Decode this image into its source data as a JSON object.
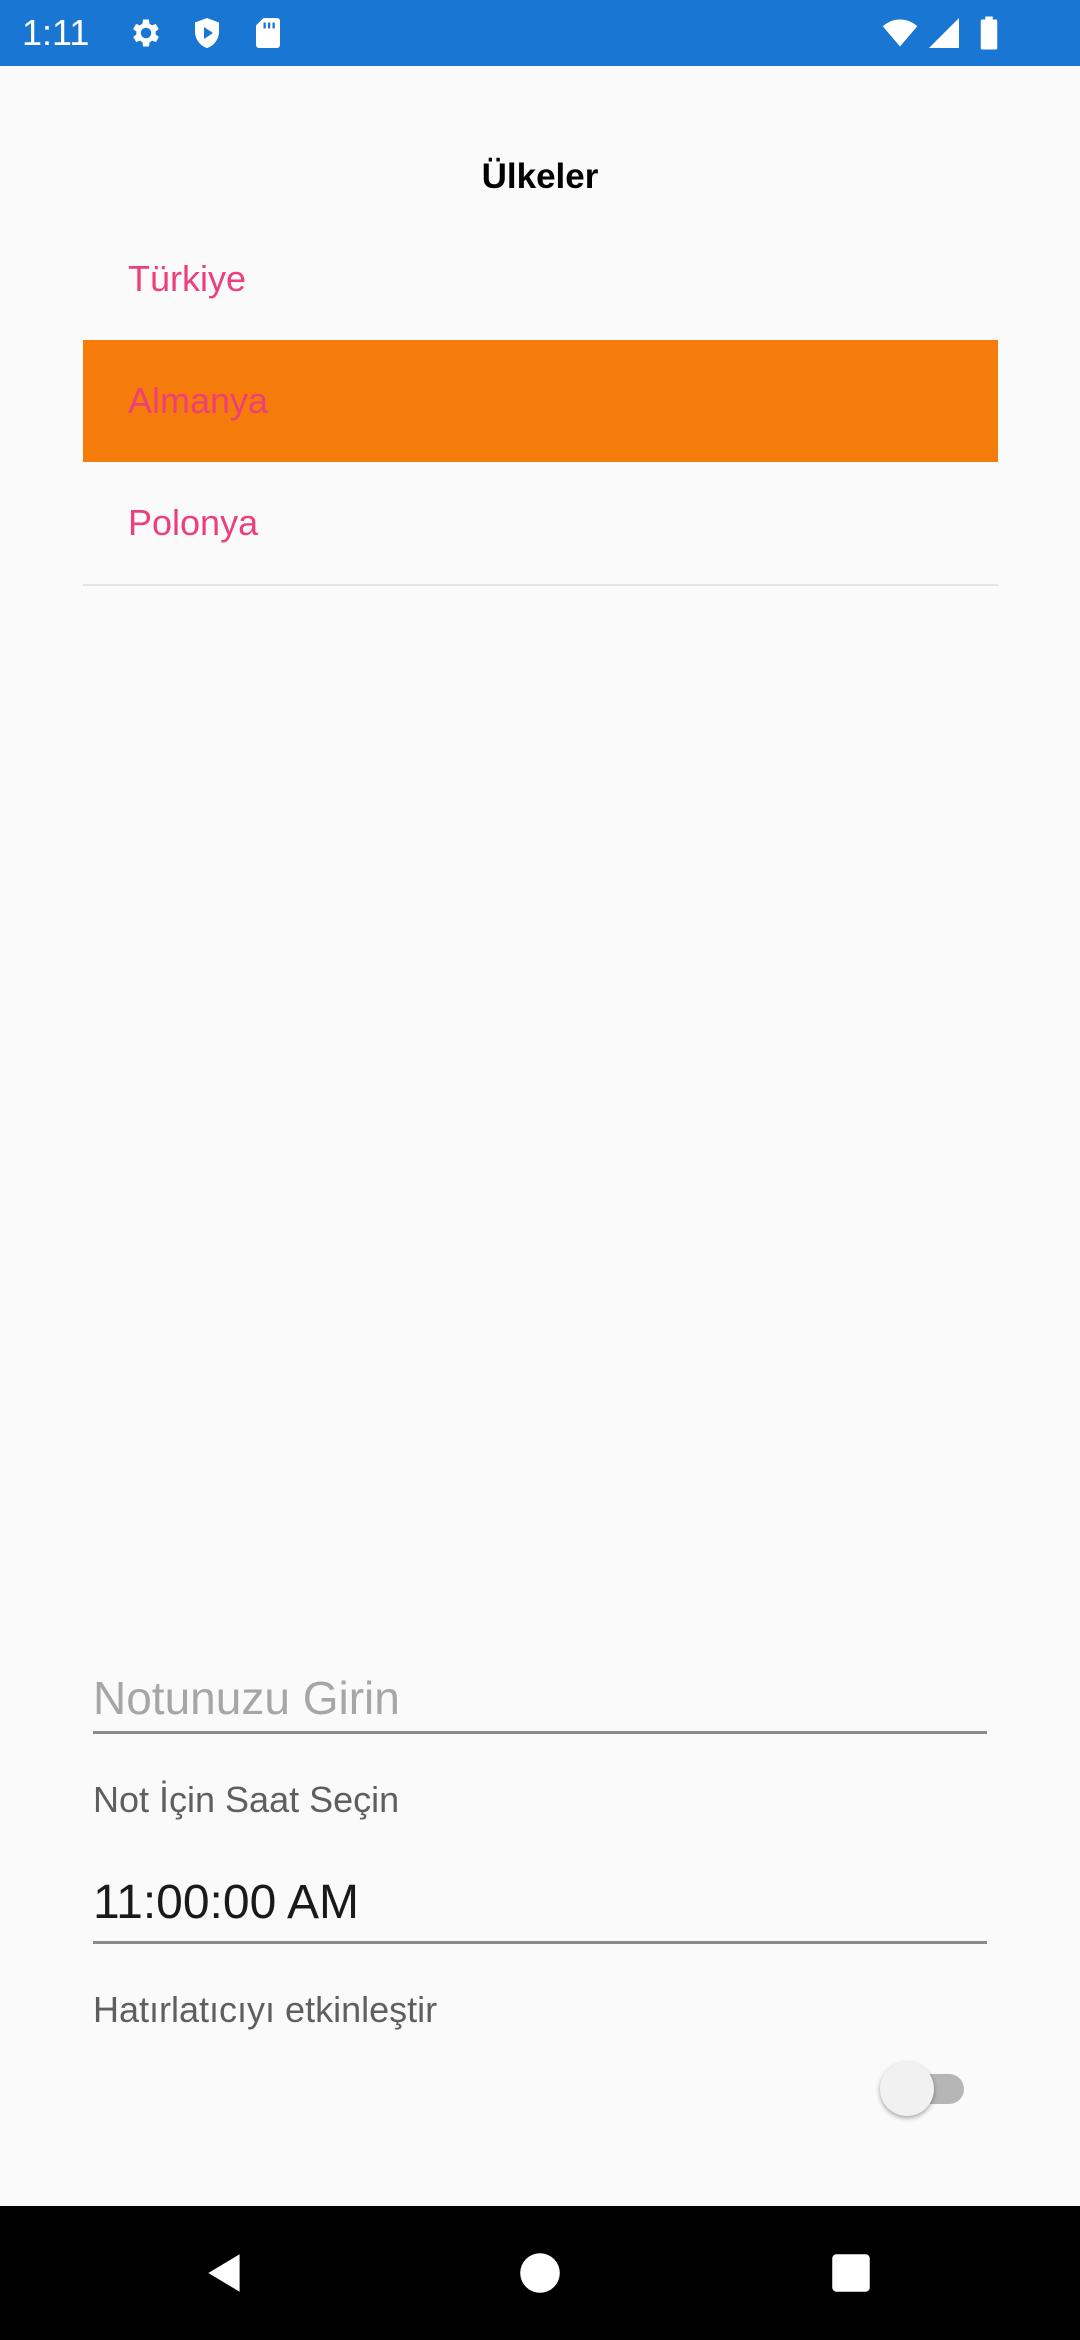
{
  "status_bar": {
    "time": "1:11",
    "background_color": "#1976d2",
    "icons_left": [
      "settings-icon",
      "play-protect-icon",
      "sd-card-icon"
    ],
    "icons_right": [
      "wifi-icon",
      "cellular-signal-icon",
      "battery-icon"
    ]
  },
  "page": {
    "title": "Ülkeler"
  },
  "countries": {
    "items": [
      {
        "label": "Türkiye",
        "selected": false
      },
      {
        "label": "Almanya",
        "selected": true
      },
      {
        "label": "Polonya",
        "selected": false
      }
    ],
    "text_color": "#ec407a",
    "selected_background": "#f57c0b"
  },
  "note": {
    "placeholder": "Notunuzu Girin",
    "value": ""
  },
  "time_select": {
    "label": "Not İçin Saat Seçin",
    "value": "11:00:00 AM"
  },
  "reminder": {
    "label": "Hatırlatıcıyı etkinleştir",
    "enabled": false
  },
  "nav_bar": {
    "buttons": [
      "back-icon",
      "home-icon",
      "recents-icon"
    ]
  }
}
